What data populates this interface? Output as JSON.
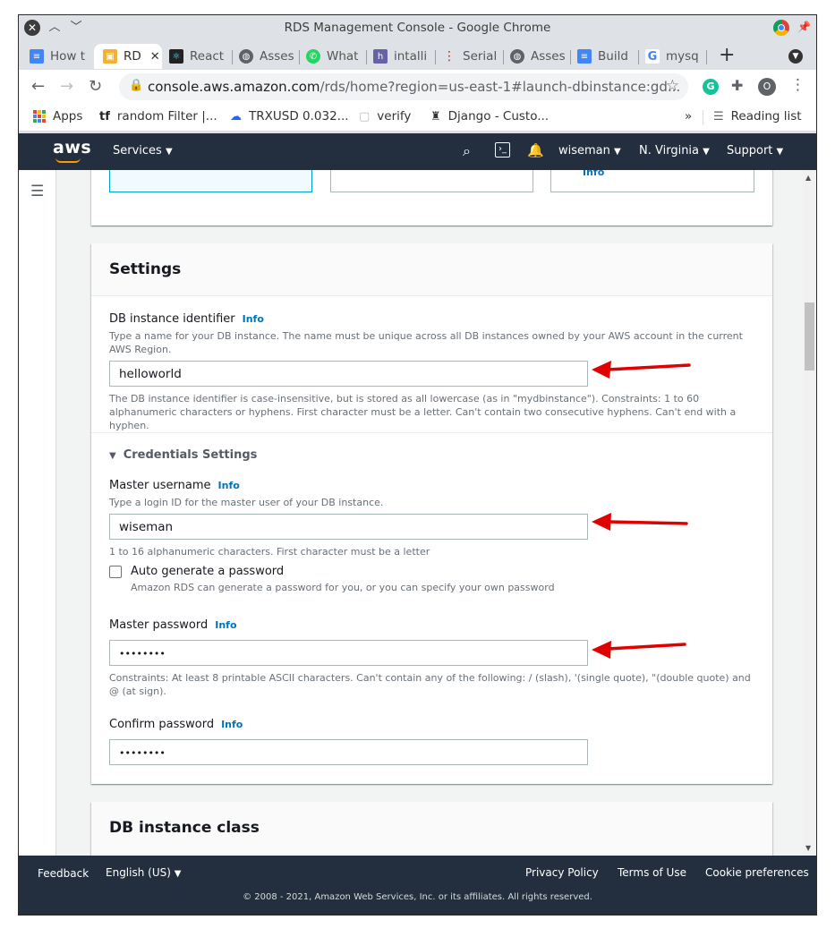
{
  "window": {
    "title": "RDS Management Console - Google Chrome"
  },
  "tabs": [
    {
      "label": "How t",
      "icon": "docs-icon"
    },
    {
      "label": "RD",
      "icon": "aws-icon",
      "active": true
    },
    {
      "label": "React",
      "icon": "react-icon"
    },
    {
      "label": "Asses",
      "icon": "globe-icon"
    },
    {
      "label": "What",
      "icon": "whatsapp-icon"
    },
    {
      "label": "intalli",
      "icon": "heroku-icon"
    },
    {
      "label": "Serial",
      "icon": "serial-icon"
    },
    {
      "label": "Asses",
      "icon": "globe-icon"
    },
    {
      "label": "Build",
      "icon": "docs-icon"
    },
    {
      "label": "mysq",
      "icon": "google-icon"
    }
  ],
  "address": {
    "host": "console.aws.amazon.com",
    "path": "/rds/home?region=us-east-1#launch-dbinstance:gd..."
  },
  "bookmarks": {
    "items": [
      {
        "label": "Apps"
      },
      {
        "label": "random Filter |..."
      },
      {
        "label": "TRXUSD 0.032..."
      },
      {
        "label": "verify"
      },
      {
        "label": "Django - Custo..."
      }
    ],
    "reading_list": "Reading list",
    "overflow": "»"
  },
  "aws": {
    "logo": "aws",
    "services": "Services",
    "user": "wiseman",
    "region": "N. Virginia",
    "support": "Support"
  },
  "top_partial": {
    "info": "Info"
  },
  "settings": {
    "heading": "Settings",
    "identifier": {
      "label": "DB instance identifier",
      "info": "Info",
      "desc": "Type a name for your DB instance. The name must be unique across all DB instances owned by your AWS account in the current AWS Region.",
      "value": "helloworld",
      "constraint": "The DB instance identifier is case-insensitive, but is stored as all lowercase (as in \"mydbinstance\"). Constraints: 1 to 60 alphanumeric characters or hyphens. First character must be a letter. Can't contain two consecutive hyphens. Can't end with a hyphen."
    },
    "credentials": {
      "heading": "Credentials Settings",
      "username": {
        "label": "Master username",
        "info": "Info",
        "desc": "Type a login ID for the master user of your DB instance.",
        "value": "wiseman",
        "constraint": "1 to 16 alphanumeric characters. First character must be a letter"
      },
      "autogen": {
        "label": "Auto generate a password",
        "desc": "Amazon RDS can generate a password for you, or you can specify your own password",
        "checked": false
      },
      "password": {
        "label": "Master password",
        "info": "Info",
        "value": "••••••••",
        "constraint": "Constraints: At least 8 printable ASCII characters. Can't contain any of the following: / (slash), '(single quote), \"(double quote) and @ (at sign)."
      },
      "confirm": {
        "label": "Confirm password",
        "info": "Info",
        "value": "••••••••"
      }
    }
  },
  "instance_class": {
    "heading": "DB instance class"
  },
  "footer": {
    "feedback": "Feedback",
    "language": "English (US)",
    "privacy": "Privacy Policy",
    "terms": "Terms of Use",
    "cookies": "Cookie preferences",
    "copyright": "© 2008 - 2021, Amazon Web Services, Inc. or its affiliates. All rights reserved."
  },
  "colors": {
    "aws_header": "#232f3e",
    "link": "#0073bb",
    "arrow": "#e00000"
  }
}
